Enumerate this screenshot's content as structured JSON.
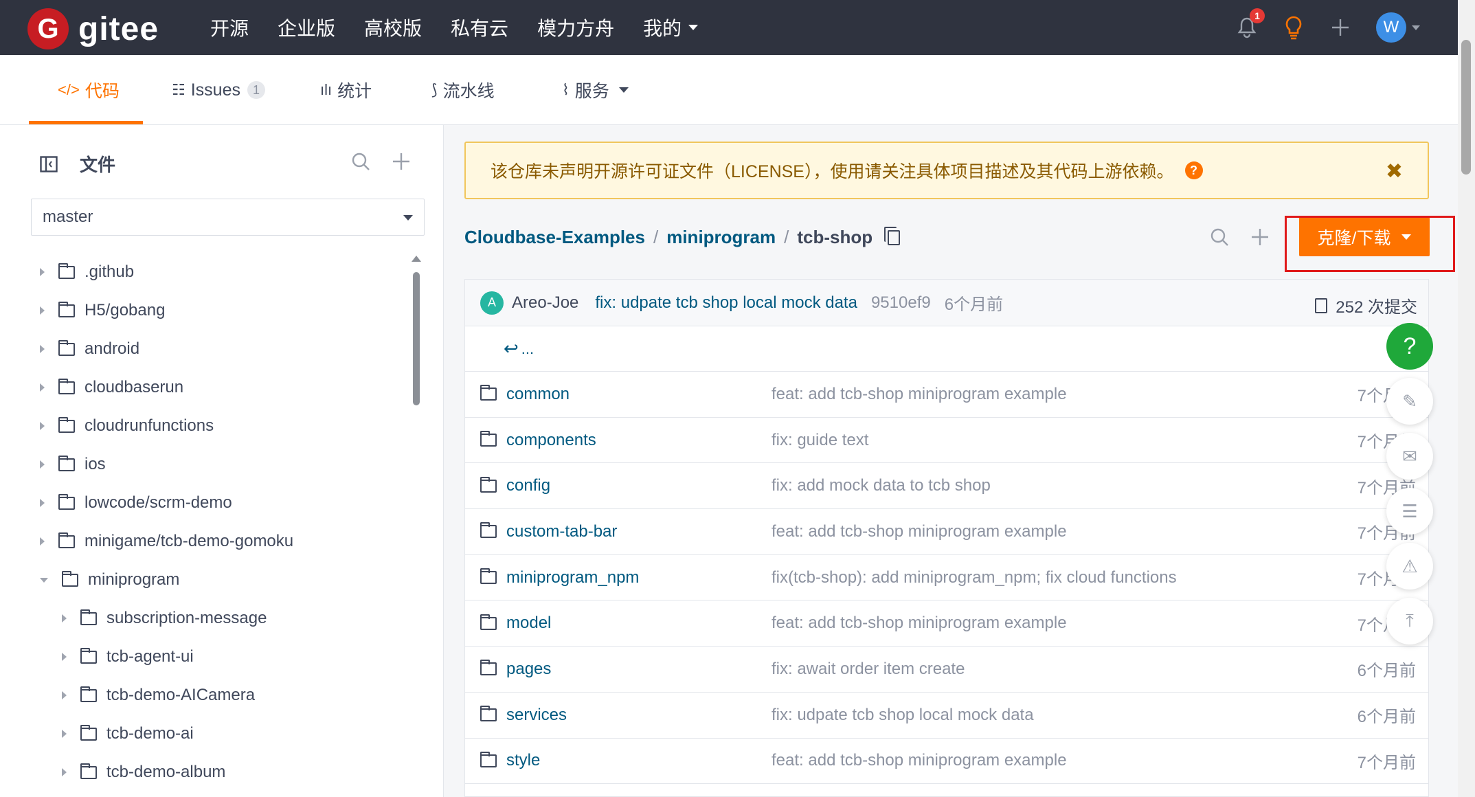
{
  "topnav": {
    "logo_letter": "G",
    "logo_text": "gitee",
    "items": [
      "开源",
      "企业版",
      "高校版",
      "私有云",
      "模力方舟",
      "我的"
    ],
    "notification_count": "1",
    "avatar_letter": "W",
    "icons": [
      "bell-icon",
      "lightbulb-icon",
      "plus-icon"
    ]
  },
  "tabs": [
    {
      "icon": "</>",
      "label": "代码",
      "active": true
    },
    {
      "icon": "☷",
      "label": "Issues",
      "count": "1"
    },
    {
      "icon": "ılı",
      "label": "统计"
    },
    {
      "icon": "⟆",
      "label": "流水线"
    },
    {
      "icon": "⌇",
      "label": "服务"
    }
  ],
  "sidebar": {
    "title": "文件",
    "branch": "master",
    "tree": [
      {
        "name": ".github",
        "level": 0,
        "open": false
      },
      {
        "name": "H5/gobang",
        "level": 0,
        "open": false
      },
      {
        "name": "android",
        "level": 0,
        "open": false
      },
      {
        "name": "cloudbaserun",
        "level": 0,
        "open": false
      },
      {
        "name": "cloudrunfunctions",
        "level": 0,
        "open": false
      },
      {
        "name": "ios",
        "level": 0,
        "open": false
      },
      {
        "name": "lowcode/scrm-demo",
        "level": 0,
        "open": false
      },
      {
        "name": "minigame/tcb-demo-gomoku",
        "level": 0,
        "open": false
      },
      {
        "name": "miniprogram",
        "level": 0,
        "open": true
      },
      {
        "name": "subscription-message",
        "level": 1,
        "open": false
      },
      {
        "name": "tcb-agent-ui",
        "level": 1,
        "open": false
      },
      {
        "name": "tcb-demo-AICamera",
        "level": 1,
        "open": false
      },
      {
        "name": "tcb-demo-ai",
        "level": 1,
        "open": false
      },
      {
        "name": "tcb-demo-album",
        "level": 1,
        "open": false
      }
    ]
  },
  "notice": {
    "text": "该仓库未声明开源许可证文件（LICENSE），使用请关注具体项目描述及其代码上游依赖。",
    "help": "?",
    "close": "✖"
  },
  "breadcrumb": {
    "segments": [
      "Cloudbase-Examples",
      "miniprogram"
    ],
    "current": "tcb-shop",
    "sep": "/"
  },
  "clone_button": "克隆/下载",
  "commit": {
    "avatar": "A",
    "author": "Areo-Joe",
    "message": "fix: udpate tcb shop local mock data",
    "hash": "9510ef9",
    "time": "6个月前",
    "count": "252 次提交"
  },
  "back_label": "...",
  "files": [
    {
      "name": "common",
      "message": "feat: add tcb-shop miniprogram example",
      "time": "7个月前"
    },
    {
      "name": "components",
      "message": "fix: guide text",
      "time": "7个月前"
    },
    {
      "name": "config",
      "message": "fix: add mock data to tcb shop",
      "time": "7个月前"
    },
    {
      "name": "custom-tab-bar",
      "message": "feat: add tcb-shop miniprogram example",
      "time": "7个月前"
    },
    {
      "name": "miniprogram_npm",
      "message": "fix(tcb-shop): add miniprogram_npm; fix cloud functions",
      "time": "7个月前"
    },
    {
      "name": "model",
      "message": "feat: add tcb-shop miniprogram example",
      "time": "7个月前"
    },
    {
      "name": "pages",
      "message": "fix: await order item create",
      "time": "6个月前"
    },
    {
      "name": "services",
      "message": "fix: udpate tcb shop local mock data",
      "time": "6个月前"
    },
    {
      "name": "style",
      "message": "feat: add tcb-shop miniprogram example",
      "time": "7个月前"
    }
  ],
  "fabs": {
    "help": "?",
    "edit": "✎",
    "mail": "✉",
    "chat": "☰",
    "warn": "⚠",
    "top": "⤒"
  },
  "colors": {
    "accent": "#fe7300",
    "link": "#005980",
    "nav_bg": "#2f333f",
    "brand": "#c71d23"
  }
}
